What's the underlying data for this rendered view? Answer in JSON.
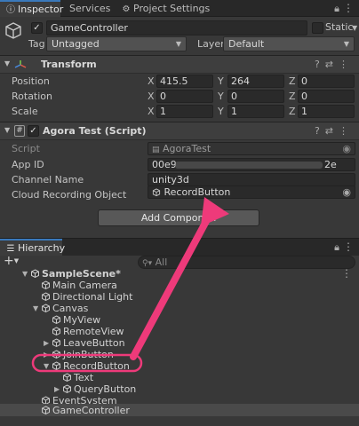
{
  "tabs": [
    {
      "label": "Inspector",
      "icon": "info-icon"
    },
    {
      "label": "Services",
      "icon": ""
    },
    {
      "label": "Project Settings",
      "icon": "gear-icon"
    }
  ],
  "object": {
    "name": "GameController",
    "active": true,
    "static_label": "Static",
    "tag_label": "Tag",
    "tag_value": "Untagged",
    "layer_label": "Layer",
    "layer_value": "Default"
  },
  "transform": {
    "title": "Transform",
    "position": {
      "label": "Position",
      "x": "415.5",
      "y": "264",
      "z": "0"
    },
    "rotation": {
      "label": "Rotation",
      "x": "0",
      "y": "0",
      "z": "0"
    },
    "scale": {
      "label": "Scale",
      "x": "1",
      "y": "1",
      "z": "1"
    }
  },
  "script_component": {
    "title": "Agora Test (Script)",
    "enabled": true,
    "script_label": "Script",
    "script_value": "AgoraTest",
    "app_id_label": "App ID",
    "app_id_start": "00e9",
    "app_id_end": "2e",
    "channel_label": "Channel Name",
    "channel_value": "unity3d",
    "cloud_label": "Cloud Recording Object",
    "cloud_value": "RecordButton"
  },
  "add_component_label": "Add Componen",
  "hierarchy": {
    "title": "Hierarchy",
    "add_label": "+",
    "search_placeholder": "All",
    "scene": "SampleScene*",
    "items": [
      "Main Camera",
      "Directional Light",
      "Canvas",
      "MyView",
      "RemoteView",
      "LeaveButton",
      "JoinButton",
      "RecordButton",
      "Text",
      "QueryButton",
      "EventSystem",
      "GameController"
    ]
  },
  "colors": {
    "annotation": "#ee3a7a",
    "selection_accent": "#3a79bb"
  },
  "axes": {
    "x": "X",
    "y": "Y",
    "z": "Z"
  }
}
